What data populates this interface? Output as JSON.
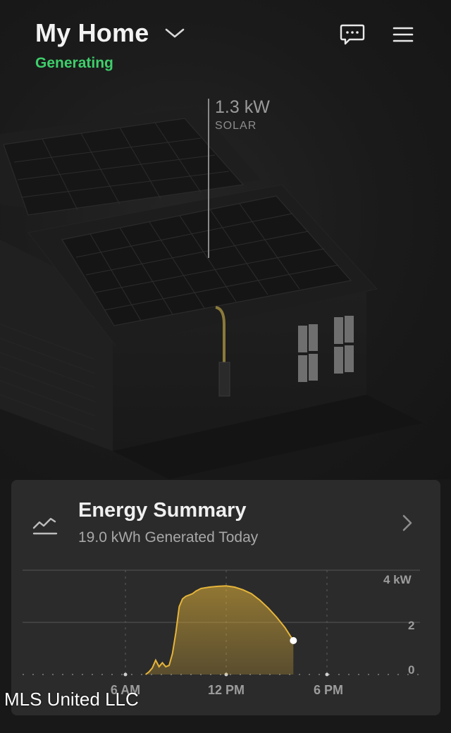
{
  "header": {
    "site_name": "My Home",
    "status": "Generating",
    "status_color": "#3ecf6b",
    "chat_icon": "chat-bubble-icon",
    "menu_icon": "hamburger-menu-icon",
    "dropdown_icon": "chevron-down-icon"
  },
  "solar_callout": {
    "value": "1.3 kW",
    "label": "SOLAR"
  },
  "energy_summary": {
    "title": "Energy Summary",
    "subtitle": "19.0 kWh Generated Today",
    "icon": "trend-line-icon",
    "nav_icon": "chevron-right-icon"
  },
  "chart_data": {
    "type": "area",
    "y_ticks": [
      "4 kW",
      "2",
      "0"
    ],
    "x_ticks": [
      "6 AM",
      "12 PM",
      "6 PM"
    ],
    "ylim": [
      0,
      4
    ],
    "xlim_hours": [
      0,
      24
    ],
    "series_color": "#e6b53a",
    "current_point": {
      "hour": 16.0,
      "kw": 1.3
    },
    "series": [
      {
        "hours": [
          7.2,
          7.4,
          7.6,
          7.8,
          8.0,
          8.2,
          8.4,
          8.6,
          8.8,
          9.0,
          9.2,
          9.4,
          9.6,
          9.8,
          10.0,
          10.2,
          10.5,
          11.0,
          11.5,
          12.0,
          12.5,
          13.0,
          13.5,
          14.0,
          14.5,
          15.0,
          15.5,
          16.0
        ],
        "kw": [
          0.0,
          0.1,
          0.25,
          0.55,
          0.3,
          0.45,
          0.3,
          0.35,
          0.8,
          1.6,
          2.6,
          2.9,
          3.0,
          3.05,
          3.1,
          3.2,
          3.3,
          3.35,
          3.38,
          3.4,
          3.35,
          3.25,
          3.1,
          2.85,
          2.55,
          2.2,
          1.8,
          1.3
        ]
      }
    ]
  },
  "watermark": "MLS United LLC"
}
